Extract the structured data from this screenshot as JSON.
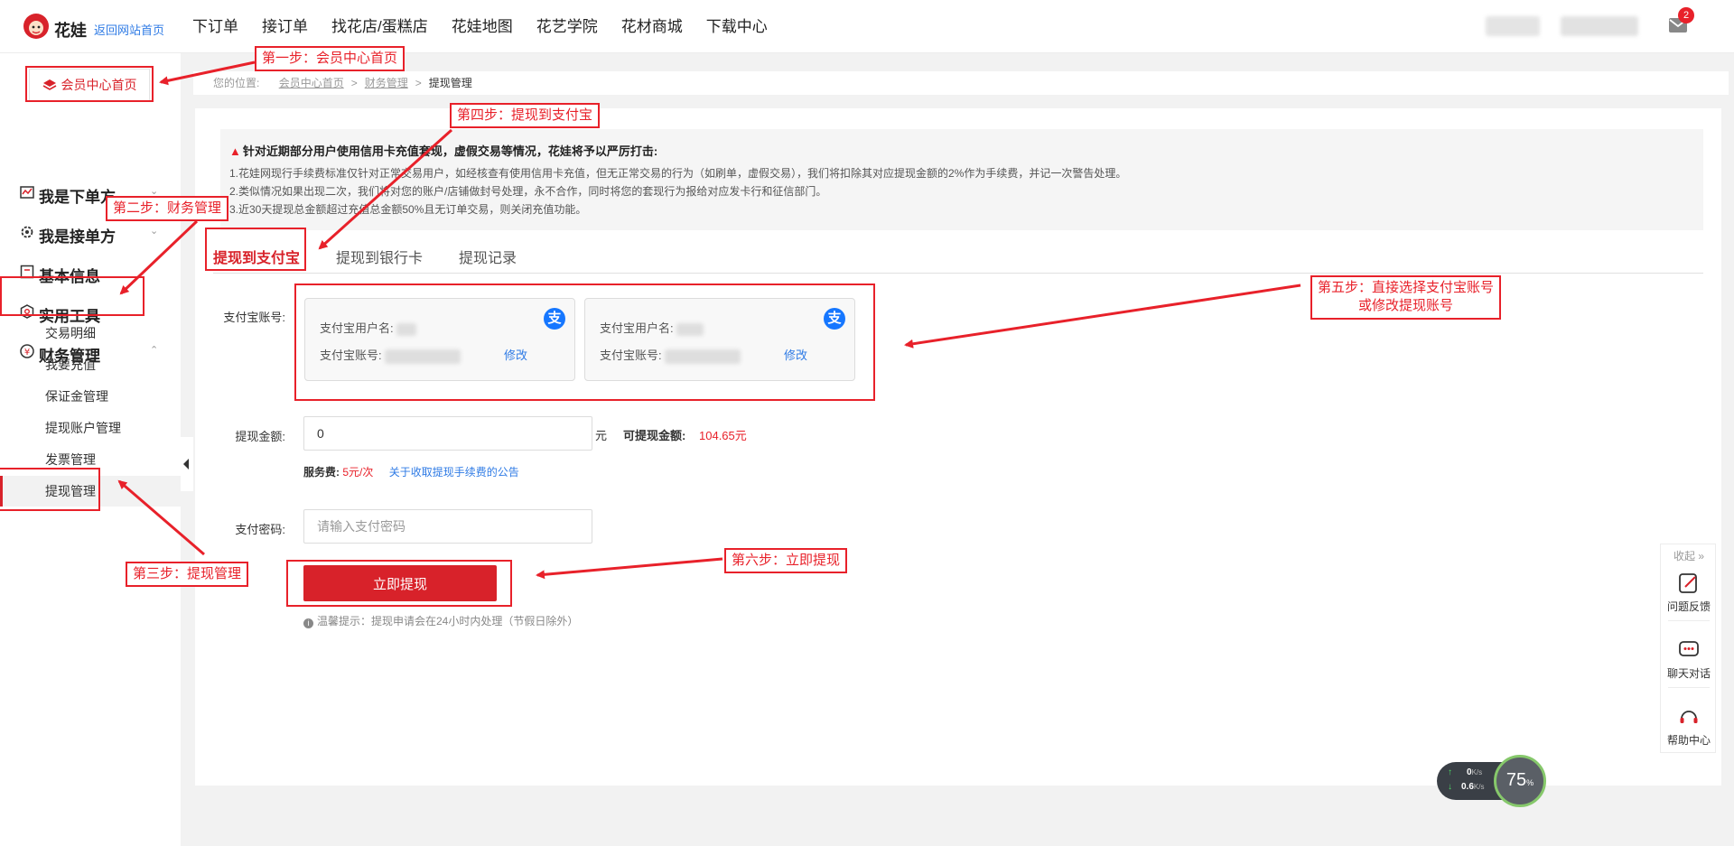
{
  "topbar": {
    "logo_text": "花娃",
    "back_home": "返回网站首页",
    "nav": [
      "下订单",
      "接订单",
      "找花店/蛋糕店",
      "花娃地图",
      "花艺学院",
      "花材商城",
      "下载中心"
    ],
    "mail_badge": "2"
  },
  "sidebar": {
    "member_home": "会员中心首页",
    "groups": [
      {
        "label": "我是下单方"
      },
      {
        "label": "我是接单方"
      },
      {
        "label": "基本信息"
      },
      {
        "label": "实用工具"
      },
      {
        "label": "财务管理"
      }
    ],
    "finance_sub": [
      "交易明细",
      "我要充值",
      "保证金管理",
      "提现账户管理",
      "发票管理",
      "提现管理"
    ]
  },
  "breadcrumb": {
    "prefix": "您的位置:",
    "items": [
      "会员中心首页",
      "财务管理"
    ],
    "current": "提现管理"
  },
  "notice": {
    "title": "针对近期部分用户使用信用卡充值套现，虚假交易等情况，花娃将予以严厉打击:",
    "lines": [
      "1.花娃网现行手续费标准仅针对正常交易用户，如经核查有使用信用卡充值，但无正常交易的行为（如刷单，虚假交易），我们将扣除其对应提现金额的2%作为手续费，并记一次警告处理。",
      "2.类似情况如果出现二次，我们将对您的账户/店铺做封号处理，永不合作，同时将您的套现行为报给对应发卡行和征信部门。",
      "3.近30天提现总金额超过充值总金额50%且无订单交易，则关闭充值功能。"
    ]
  },
  "tabs": [
    "提现到支付宝",
    "提现到银行卡",
    "提现记录"
  ],
  "form": {
    "account_label": "支付宝账号:",
    "accounts": [
      {
        "name_label": "支付宝用户名:",
        "account_label": "支付宝账号:",
        "edit": "修改"
      },
      {
        "name_label": "支付宝用户名:",
        "account_label": "支付宝账号:",
        "edit": "修改"
      }
    ],
    "amount_label": "提现金额:",
    "amount_value": "0",
    "amount_unit": "元",
    "available_label": "可提现金额:",
    "available_value": "104.65元",
    "fee_label": "服务费:",
    "fee_value": "5元/次",
    "fee_link": "关于收取提现手续费的公告",
    "password_label": "支付密码:",
    "password_placeholder": "请输入支付密码",
    "submit": "立即提现",
    "tip": "温馨提示：提现申请会在24小时内处理（节假日除外）"
  },
  "float_tools": {
    "collapse": "收起 »",
    "items": [
      "问题反馈",
      "聊天对话",
      "帮助中心"
    ]
  },
  "speed_widget": {
    "up_value": "0",
    "up_unit": "K/s",
    "down_value": "0.6",
    "down_unit": "K/s",
    "percent": "75",
    "percent_unit": "%"
  },
  "annotations": [
    "第一步：会员中心首页",
    "第二步：财务管理",
    "第三步：提现管理",
    "第四步：提现到支付宝",
    "第五步：直接选择支付宝账号",
    "或修改提现账号",
    "第六步：立即提现"
  ],
  "colors": {
    "brand_red": "#d8222a",
    "annotation_red": "#e8212a",
    "link_blue": "#2f7be5",
    "alipay_blue": "#1677ff"
  }
}
